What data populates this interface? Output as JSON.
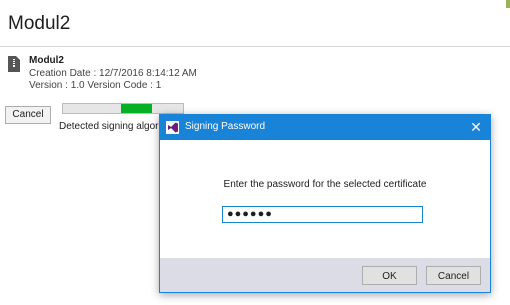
{
  "page": {
    "title": "Modul2"
  },
  "archive": {
    "name": "Modul2",
    "icon": "archive-zip-icon",
    "creation_date": "Creation Date :  12/7/2016 8:14:12 AM",
    "version_line": "Version :  1.0   Version Code :  1"
  },
  "actions": {
    "cancel_label": "Cancel"
  },
  "progress": {
    "status_text": "Detected signing algorit",
    "indicator": "indeterminate"
  },
  "dialog": {
    "title": "Signing Password",
    "icon": "visual-studio-icon",
    "close_glyph": "✕",
    "message": "Enter the password for the selected certificate",
    "password_value": "●●●●●●",
    "ok_label": "OK",
    "cancel_label": "Cancel"
  },
  "colors": {
    "accent_blue": "#1883d7",
    "progress_green": "#06b025",
    "footer_bg": "#dcdce6"
  }
}
